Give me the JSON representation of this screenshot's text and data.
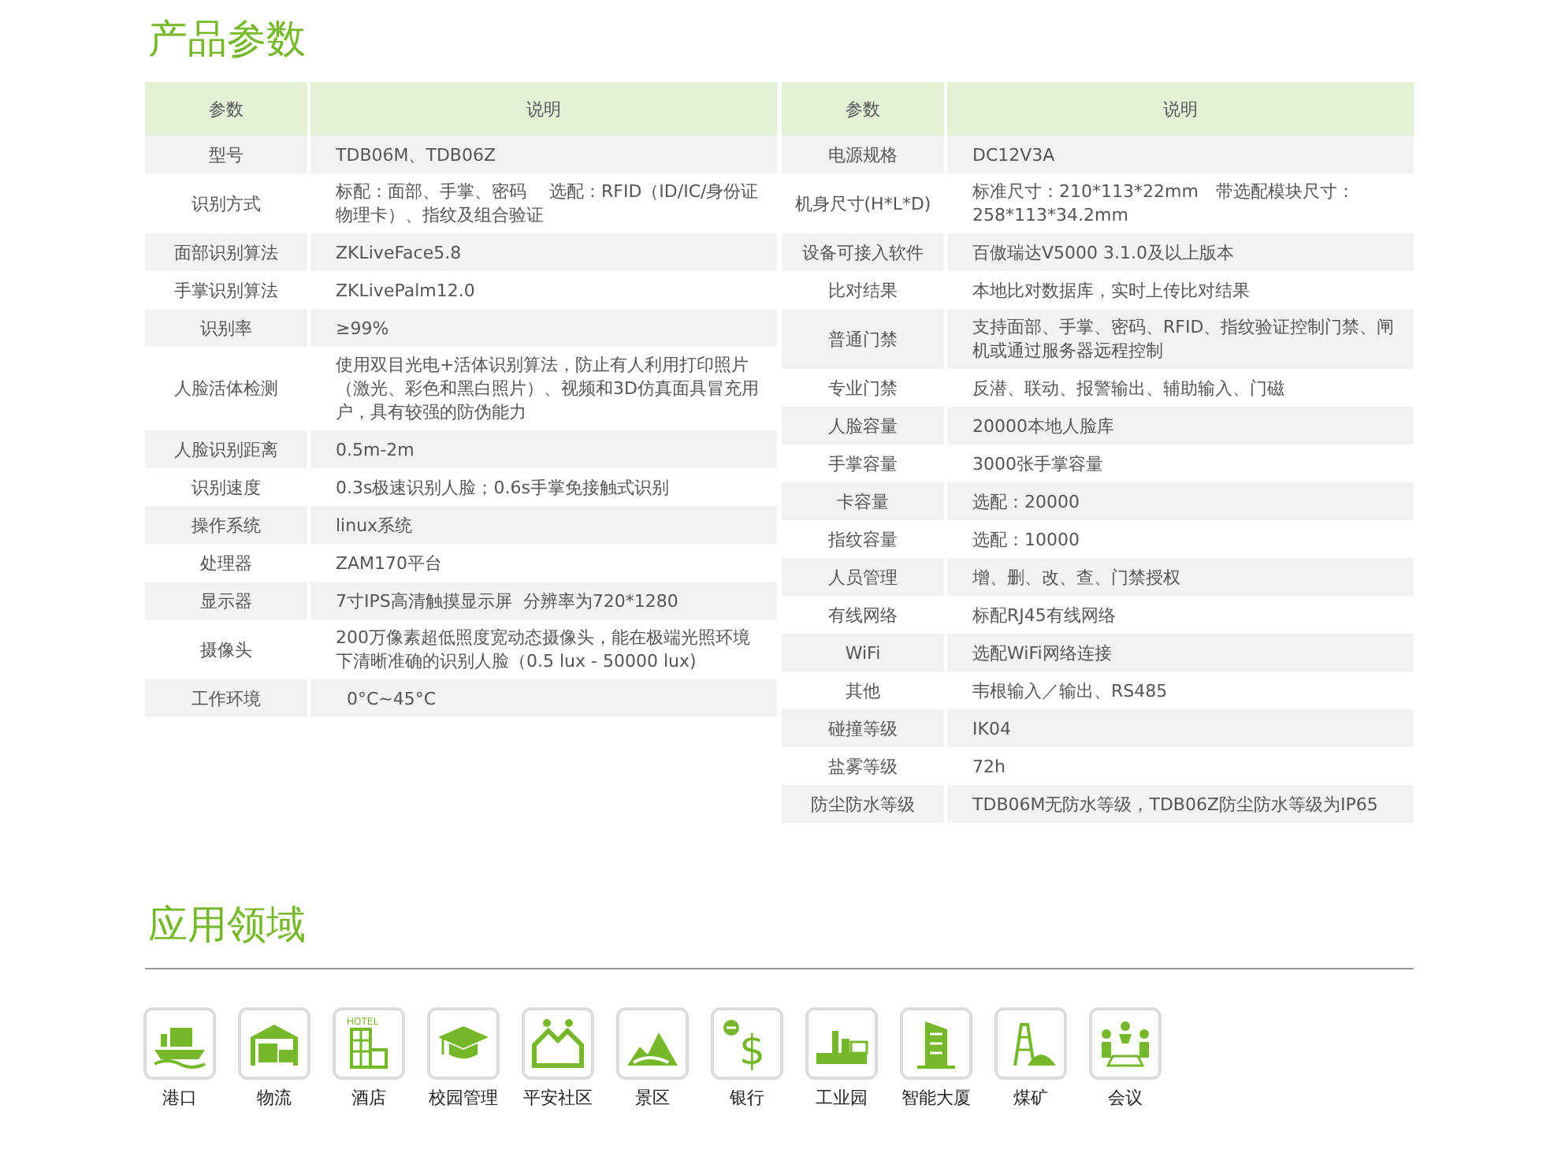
{
  "specs": {
    "title": "产品参数",
    "tables": [
      {
        "header": [
          "参数",
          "说明"
        ],
        "rows": [
          [
            "型号",
            "TDB06M、TDB06Z"
          ],
          [
            "识别方式",
            "标配：面部、手掌、密码　 选配：RFID（ID/IC/身份证物理卡）、指纹及组合验证"
          ],
          [
            "面部识别算法",
            "ZKLiveFace5.8"
          ],
          [
            "手掌识别算法",
            "ZKLivePalm12.0"
          ],
          [
            "识别率",
            "≥99%"
          ],
          [
            "人脸活体检测",
            "使用双目光电+活体识别算法，防止有人利用打印照片（激光、彩色和黑白照片）、视频和3D仿真面具冒充用户，具有较强的防伪能力"
          ],
          [
            "人脸识别距离",
            "0.5m-2m"
          ],
          [
            "识别速度",
            "0.3s极速识别人脸；0.6s手掌免接触式识别"
          ],
          [
            "操作系统",
            "linux系统"
          ],
          [
            "处理器",
            "ZAM170平台"
          ],
          [
            "显示器",
            "7寸IPS高清触摸显示屏  分辨率为720*1280"
          ],
          [
            "摄像头",
            "200万像素超低照度宽动态摄像头，能在极端光照环境下清晰准确的识别人脸（0.5 lux - 50000 lux)"
          ],
          [
            "工作环境",
            "  0°C~45°C"
          ]
        ]
      },
      {
        "header": [
          "参数",
          "说明"
        ],
        "rows": [
          [
            "电源规格",
            "DC12V3A"
          ],
          [
            "机身尺寸(H*L*D)",
            "标准尺寸：210*113*22mm　带选配模块尺寸：258*113*34.2mm"
          ],
          [
            "设备可接入软件",
            "百傲瑞达V5000 3.1.0及以上版本"
          ],
          [
            "比对结果",
            "本地比对数据库，实时上传比对结果"
          ],
          [
            "普通门禁",
            "支持面部、手掌、密码、RFID、指纹验证控制门禁、闸机或通过服务器远程控制"
          ],
          [
            "专业门禁",
            "反潜、联动、报警输出、辅助输入、门磁"
          ],
          [
            "人脸容量",
            "20000本地人脸库"
          ],
          [
            "手掌容量",
            "3000张手掌容量"
          ],
          [
            "卡容量",
            "选配：20000"
          ],
          [
            "指纹容量",
            "选配：10000"
          ],
          [
            "人员管理",
            "增、删、改、查、门禁授权"
          ],
          [
            "有线网络",
            "标配RJ45有线网络"
          ],
          [
            "WiFi",
            "选配WiFi网络连接"
          ],
          [
            "其他",
            "韦根输入／输出、RS485"
          ],
          [
            "碰撞等级",
            "IK04"
          ],
          [
            "盐雾等级",
            "72h"
          ],
          [
            "防尘防水等级",
            "TDB06M无防水等级，TDB06Z防尘防水等级为IP65"
          ]
        ]
      }
    ]
  },
  "applications": {
    "title": "应用领域",
    "items": [
      {
        "label": "港口"
      },
      {
        "label": "物流"
      },
      {
        "label": "酒店",
        "icon_text": "HOTEL"
      },
      {
        "label": "校园管理"
      },
      {
        "label": "平安社区"
      },
      {
        "label": "景区"
      },
      {
        "label": "银行",
        "icon_text": "$"
      },
      {
        "label": "工业园"
      },
      {
        "label": "智能大厦"
      },
      {
        "label": "煤矿"
      },
      {
        "label": "会议"
      }
    ]
  }
}
